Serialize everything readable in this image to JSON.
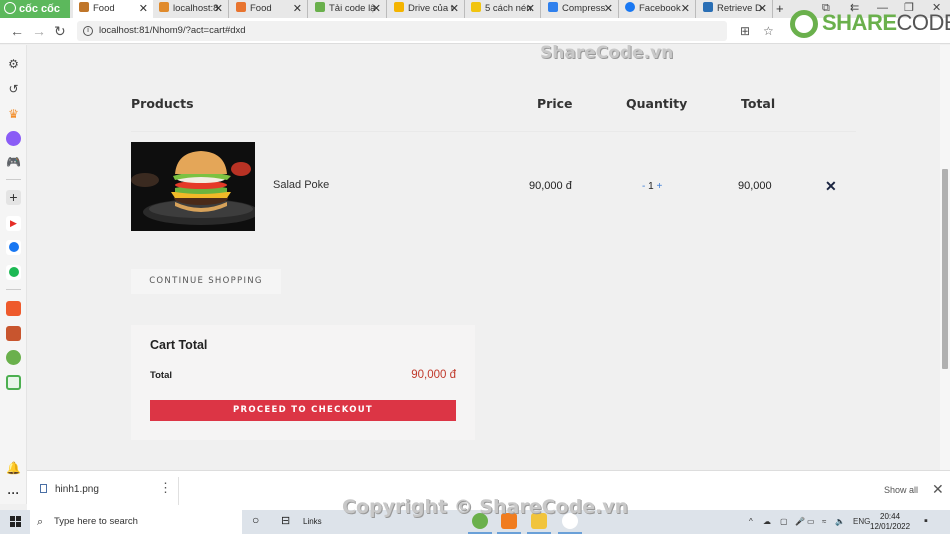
{
  "browser": {
    "brand": "cốc cốc",
    "tabs": [
      {
        "label": "Food",
        "active": true,
        "icon_color": "#c0762a"
      },
      {
        "label": "localhost:8",
        "active": false,
        "icon_color": "#e08a2b"
      },
      {
        "label": "Food",
        "active": false,
        "icon_color": "#e8742f"
      },
      {
        "label": "Tải code lậ",
        "active": false,
        "icon_color": "#6ab04c"
      },
      {
        "label": "Drive của t",
        "active": false,
        "icon_color": "#f4b400"
      },
      {
        "label": "5 cách nén",
        "active": false,
        "icon_color": "#f1c40f"
      },
      {
        "label": "Compress",
        "active": false,
        "icon_color": "#2f80ed"
      },
      {
        "label": "Facebook",
        "active": false,
        "icon_color": "#1877f2"
      },
      {
        "label": "Retrieve D",
        "active": false,
        "icon_color": "#2a6fb5"
      }
    ],
    "new_tab": "+",
    "url": "localhost:81/Nhom9/?act=cart#dxd"
  },
  "watermarks": {
    "logo_main": "SHARE",
    "logo_rest": "CODE.vn",
    "top": "ShareCode.vn",
    "bottom": "Copyright © ShareCode.vn"
  },
  "cart_table": {
    "headers": {
      "products": "Products",
      "price": "Price",
      "quantity": "Quantity",
      "total": "Total"
    },
    "rows": [
      {
        "name": "Salad Poke",
        "price": "90,000 đ",
        "qty_minus": "-",
        "qty": "1",
        "qty_plus": "+",
        "total": "90,000",
        "remove": "✕"
      }
    ]
  },
  "continue_shopping": "CONTINUE SHOPPING",
  "cart_total": {
    "title": "Cart Total",
    "label": "Total",
    "value": "90,000 đ",
    "checkout": "PROCEED TO CHECKOUT"
  },
  "colors": {
    "accent": "#dc3545",
    "price_red": "#c0392b"
  },
  "download_bar": {
    "file": "hinh1.png",
    "show_all": "Show all"
  },
  "taskbar": {
    "search_placeholder": "Type here to search",
    "links": "Links",
    "lang": "ENG",
    "time": "20:44",
    "date": "12/01/2022"
  }
}
